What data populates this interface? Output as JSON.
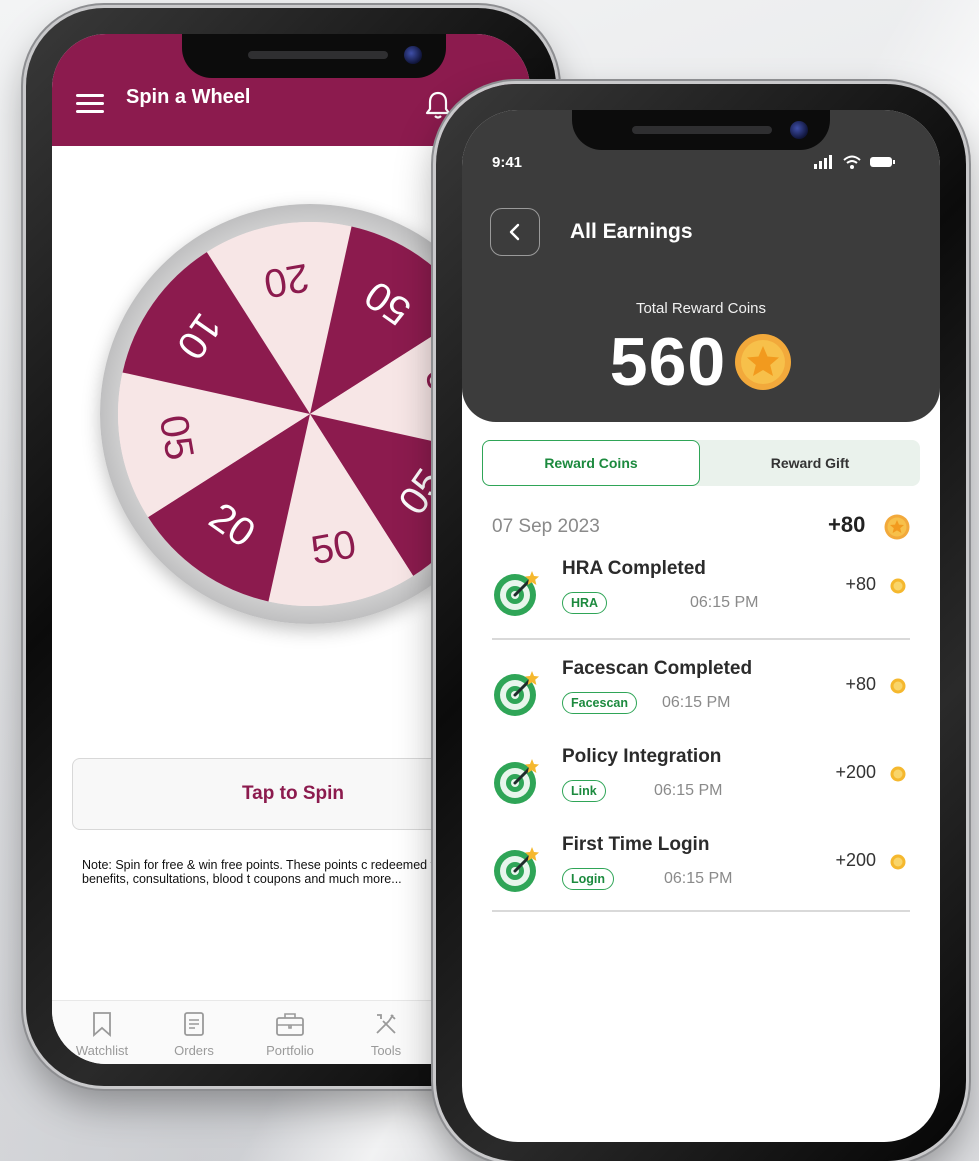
{
  "spin_app": {
    "title": "Spin a Wheel",
    "wheel_segments": [
      "20",
      "50",
      "10",
      "05",
      "50",
      "20",
      "05",
      "10"
    ],
    "spin_button_label": "Tap to Spin",
    "note": "Note: Spin for free & win free points. These points c redeemed for health benefits, consultations, blood t coupons and much more...",
    "tabs": [
      "Watchlist",
      "Orders",
      "Portfolio",
      "Tools"
    ],
    "colors": {
      "brand": "#8c1b4e",
      "wheel_light": "#f7e6e6"
    }
  },
  "earnings_app": {
    "status_time": "9:41",
    "title": "All Earnings",
    "total_label": "Total Reward Coins",
    "total_value": "560",
    "tabs": {
      "active": "Reward Coins",
      "inactive": "Reward Gift"
    },
    "date": "07 Sep 2023",
    "date_total": "+80",
    "items": [
      {
        "title": "HRA Completed",
        "tag": "HRA",
        "time": "06:15 PM",
        "points": "+80"
      },
      {
        "title": "Facescan Completed",
        "tag": "Facescan",
        "time": "06:15 PM",
        "points": "+80"
      },
      {
        "title": "Policy Integration",
        "tag": "Link",
        "time": "06:15 PM",
        "points": "+200"
      },
      {
        "title": "First Time Login",
        "tag": "Login",
        "time": "06:15 PM",
        "points": "+200"
      }
    ],
    "colors": {
      "accent_green": "#2fa557",
      "coin": "#f5b82e",
      "header_dark": "#3c3c3c"
    }
  }
}
